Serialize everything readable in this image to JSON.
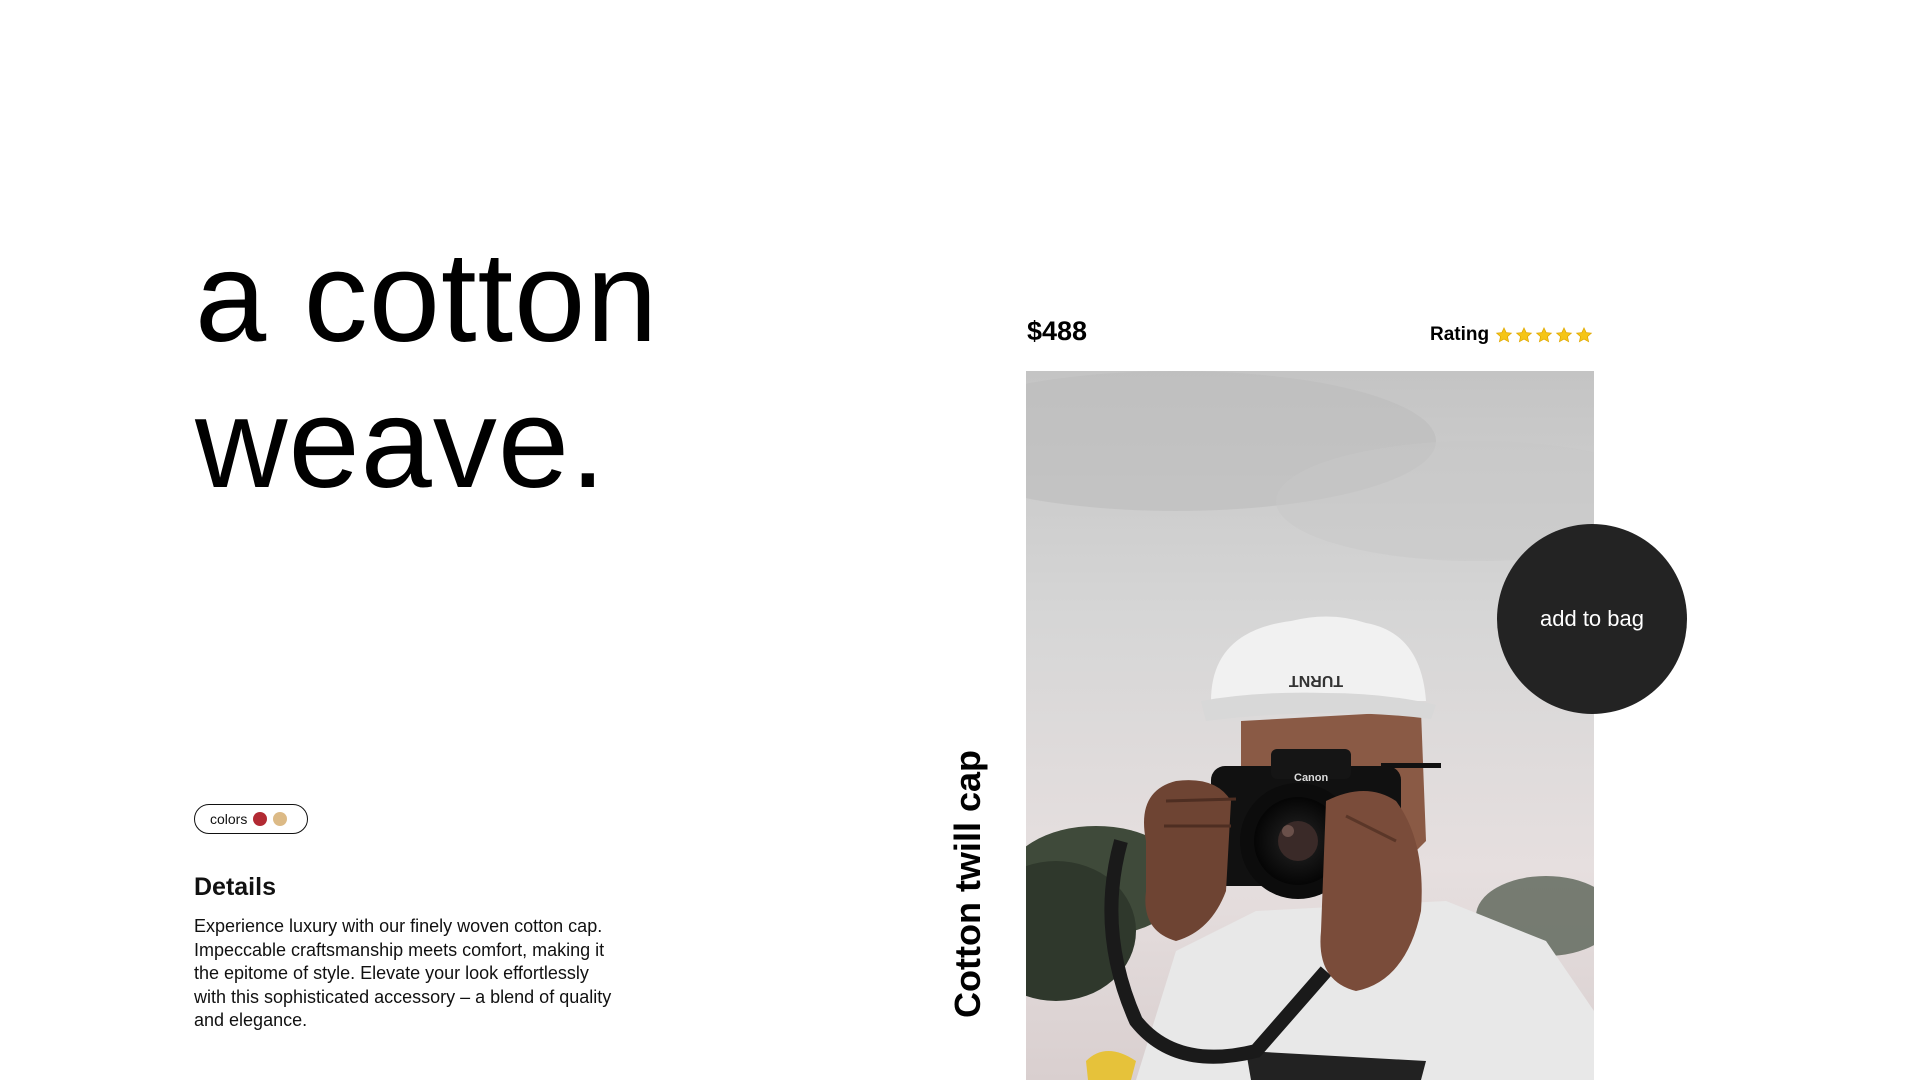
{
  "hero": {
    "line1": "a cotton",
    "line2": "weave."
  },
  "colors": {
    "label": "colors",
    "swatches": [
      "#b22a33",
      "#dcba86"
    ]
  },
  "details": {
    "title": "Details",
    "text": "Experience luxury with our finely woven cotton cap. Impeccable craftsmanship meets comfort, making it the epitome of style. Elevate your look effortlessly with this sophisticated accessory – a blend of quality and elegance."
  },
  "product": {
    "price": "$488",
    "rating_label": "Rating",
    "rating_stars": 5,
    "rating_max": 5,
    "star_color": "#f5c518",
    "name": "Cotton twill cap",
    "image_icon": "photo-man-with-camera-and-cap",
    "cap_text": "TURNT",
    "camera_brand": "Canon"
  },
  "actions": {
    "add_to_bag": "add to bag",
    "button_color": "#232323"
  }
}
